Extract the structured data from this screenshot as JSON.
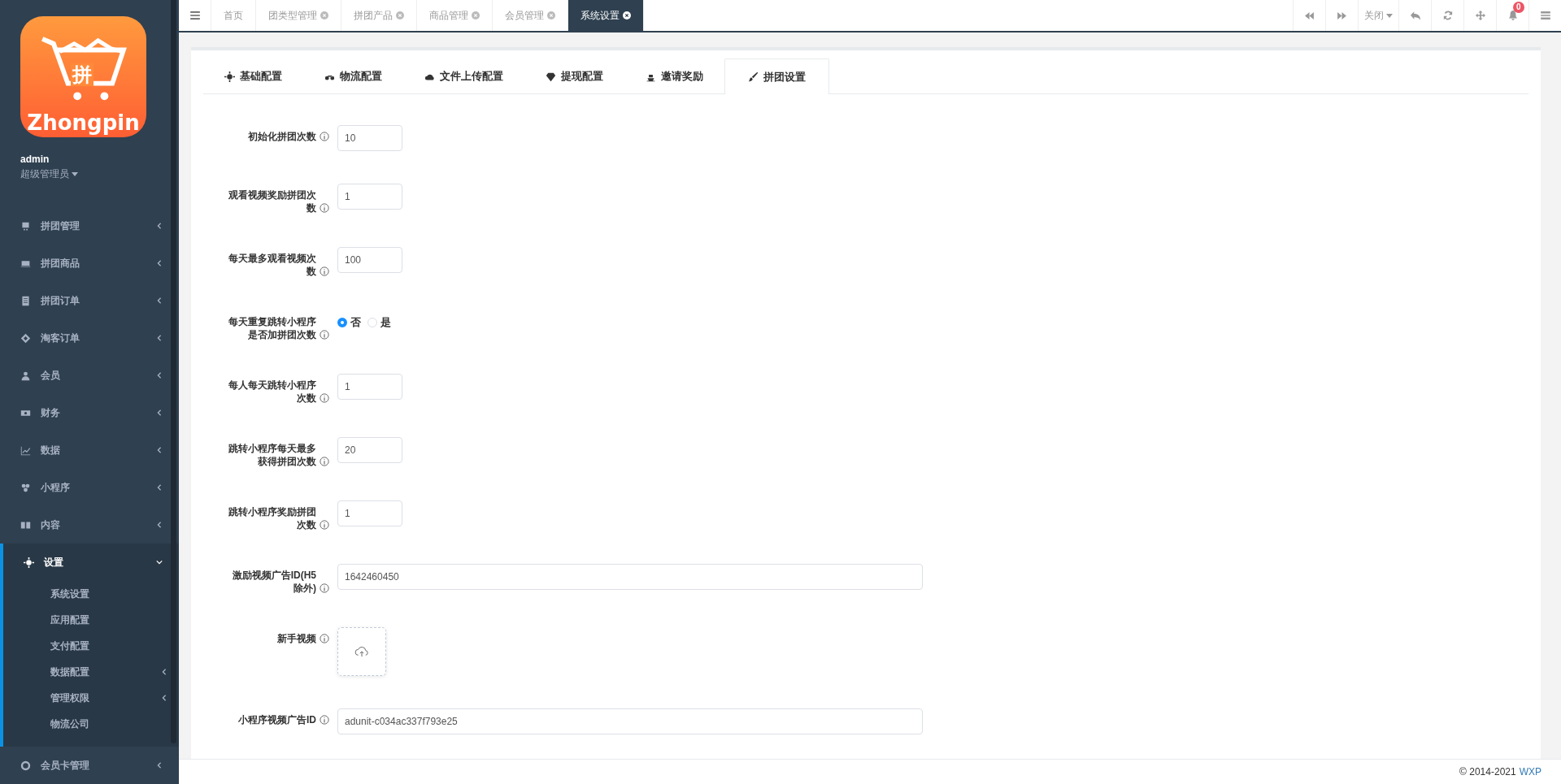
{
  "logo": {
    "char": "拼",
    "name": "Zhongpin"
  },
  "user": {
    "name": "admin",
    "role": "超级管理员"
  },
  "sidebar": {
    "items": [
      {
        "label": "拼团管理",
        "expanded": false
      },
      {
        "label": "拼团商品",
        "expanded": false
      },
      {
        "label": "拼团订单",
        "expanded": false
      },
      {
        "label": "淘客订单",
        "expanded": false
      },
      {
        "label": "会员",
        "expanded": false
      },
      {
        "label": "财务",
        "expanded": false
      },
      {
        "label": "数据",
        "expanded": false
      },
      {
        "label": "小程序",
        "expanded": false
      },
      {
        "label": "内容",
        "expanded": false
      },
      {
        "label": "设置",
        "expanded": true,
        "children": [
          {
            "label": "系统设置",
            "has_submenu": false
          },
          {
            "label": "应用配置",
            "has_submenu": false
          },
          {
            "label": "支付配置",
            "has_submenu": false
          },
          {
            "label": "数据配置",
            "has_submenu": true
          },
          {
            "label": "管理权限",
            "has_submenu": true
          },
          {
            "label": "物流公司",
            "has_submenu": false
          }
        ]
      },
      {
        "label": "会员卡管理",
        "expanded": false
      }
    ]
  },
  "page_tabs": [
    {
      "label": "首页",
      "closable": false,
      "selected": false
    },
    {
      "label": "团类型管理",
      "closable": true,
      "selected": false
    },
    {
      "label": "拼团产品",
      "closable": true,
      "selected": false
    },
    {
      "label": "商品管理",
      "closable": true,
      "selected": false
    },
    {
      "label": "会员管理",
      "closable": true,
      "selected": false
    },
    {
      "label": "系统设置",
      "closable": true,
      "selected": true
    }
  ],
  "toolbar": {
    "close_label": "关闭",
    "notification_count": "0"
  },
  "settings_tabs": [
    {
      "label": "基础配置",
      "selected": false
    },
    {
      "label": "物流配置",
      "selected": false
    },
    {
      "label": "文件上传配置",
      "selected": false
    },
    {
      "label": "提现配置",
      "selected": false
    },
    {
      "label": "邀请奖励",
      "selected": false
    },
    {
      "label": "拼团设置",
      "selected": true
    }
  ],
  "form": [
    {
      "kind": "number",
      "label": "初始化拼团次数",
      "value": "10"
    },
    {
      "kind": "number",
      "label": "观看视频奖励拼团次数",
      "value": "1"
    },
    {
      "kind": "number",
      "label": "每天最多观看视频次数",
      "value": "100"
    },
    {
      "kind": "radio",
      "label": "每天重复跳转小程序是否加拼团次数",
      "options": [
        {
          "label": "否",
          "selected": true
        },
        {
          "label": "是",
          "selected": false
        }
      ]
    },
    {
      "kind": "number",
      "label": "每人每天跳转小程序次数",
      "value": "1"
    },
    {
      "kind": "number",
      "label": "跳转小程序每天最多获得拼团次数",
      "value": "20"
    },
    {
      "kind": "number",
      "label": "跳转小程序奖励拼团次数",
      "value": "1"
    },
    {
      "kind": "text",
      "label": "激励视频广告ID(H5除外)",
      "value": "1642460450"
    },
    {
      "kind": "upload",
      "label": "新手视频"
    },
    {
      "kind": "text",
      "label": "小程序视频广告ID",
      "value": "adunit-c034ac337f793e25"
    }
  ],
  "footer": {
    "copyright": "© 2014-2021",
    "link": "WXP"
  }
}
